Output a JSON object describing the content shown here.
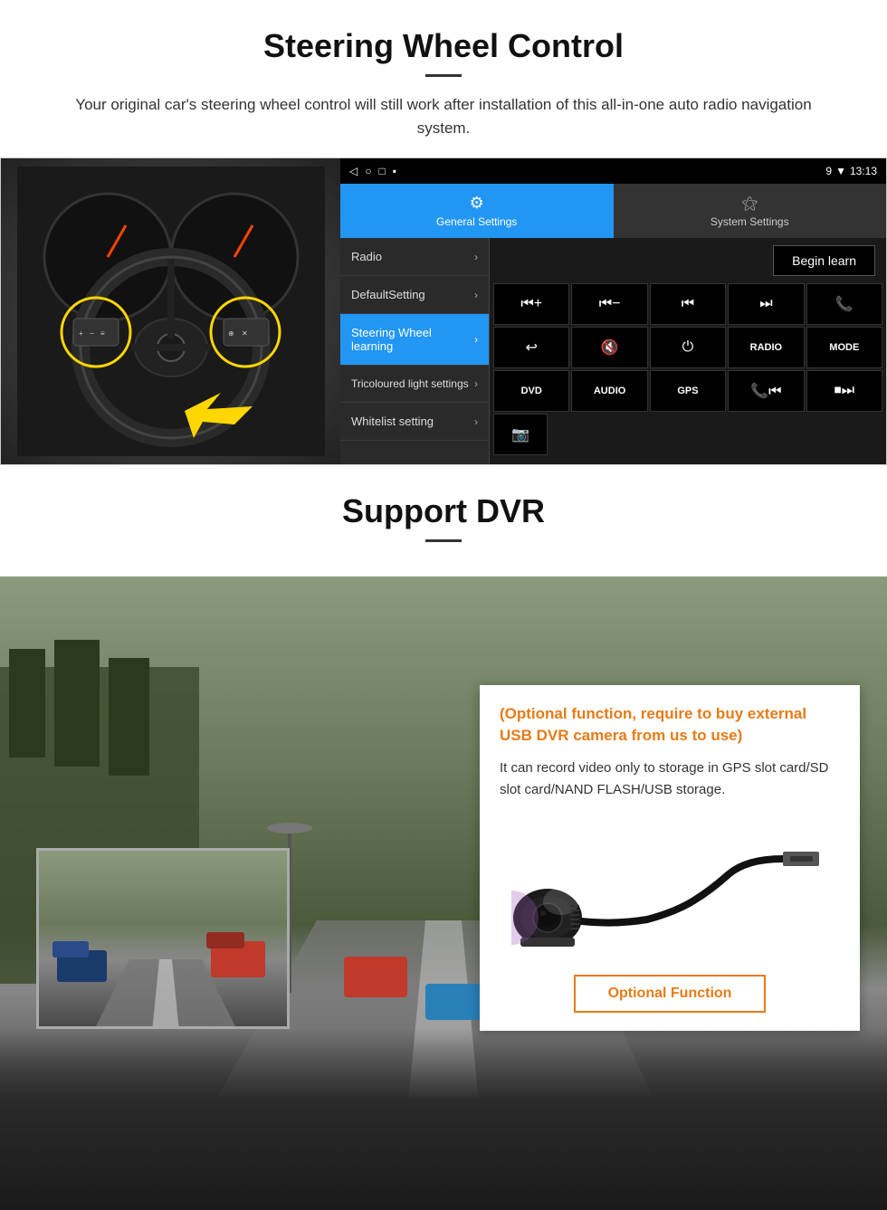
{
  "steering_section": {
    "title": "Steering Wheel Control",
    "subtitle": "Your original car's steering wheel control will still work after installation of this all-in-one auto radio navigation system.",
    "android_ui": {
      "status_bar": {
        "left_icons": [
          "◁",
          "○",
          "□",
          "▪"
        ],
        "right_icons": [
          "9",
          "▼",
          "13:13"
        ]
      },
      "tabs": [
        {
          "label": "General Settings",
          "active": true,
          "icon": "⚙"
        },
        {
          "label": "System Settings",
          "active": false,
          "icon": "☆"
        }
      ],
      "menu_items": [
        {
          "label": "Radio",
          "active": false
        },
        {
          "label": "DefaultSetting",
          "active": false
        },
        {
          "label": "Steering Wheel learning",
          "active": true
        },
        {
          "label": "Tricoloured light settings",
          "active": false
        },
        {
          "label": "Whitelist setting",
          "active": false
        }
      ],
      "begin_learn_label": "Begin learn",
      "control_buttons_row1": [
        "⏮+",
        "⏮−",
        "⏮",
        "⏭",
        "📞"
      ],
      "control_buttons_row2": [
        "↩",
        "🔇",
        "⏻",
        "RADIO",
        "MODE"
      ],
      "control_buttons_row3": [
        "DVD",
        "AUDIO",
        "GPS",
        "📞⏮",
        "⏹⏭"
      ],
      "control_buttons_row4_icon": "📷"
    }
  },
  "dvr_section": {
    "title": "Support DVR",
    "optional_text": "(Optional function, require to buy external USB DVR camera from us to use)",
    "description": "It can record video only to storage in GPS slot card/SD slot card/NAND FLASH/USB storage.",
    "optional_button_label": "Optional Function"
  }
}
